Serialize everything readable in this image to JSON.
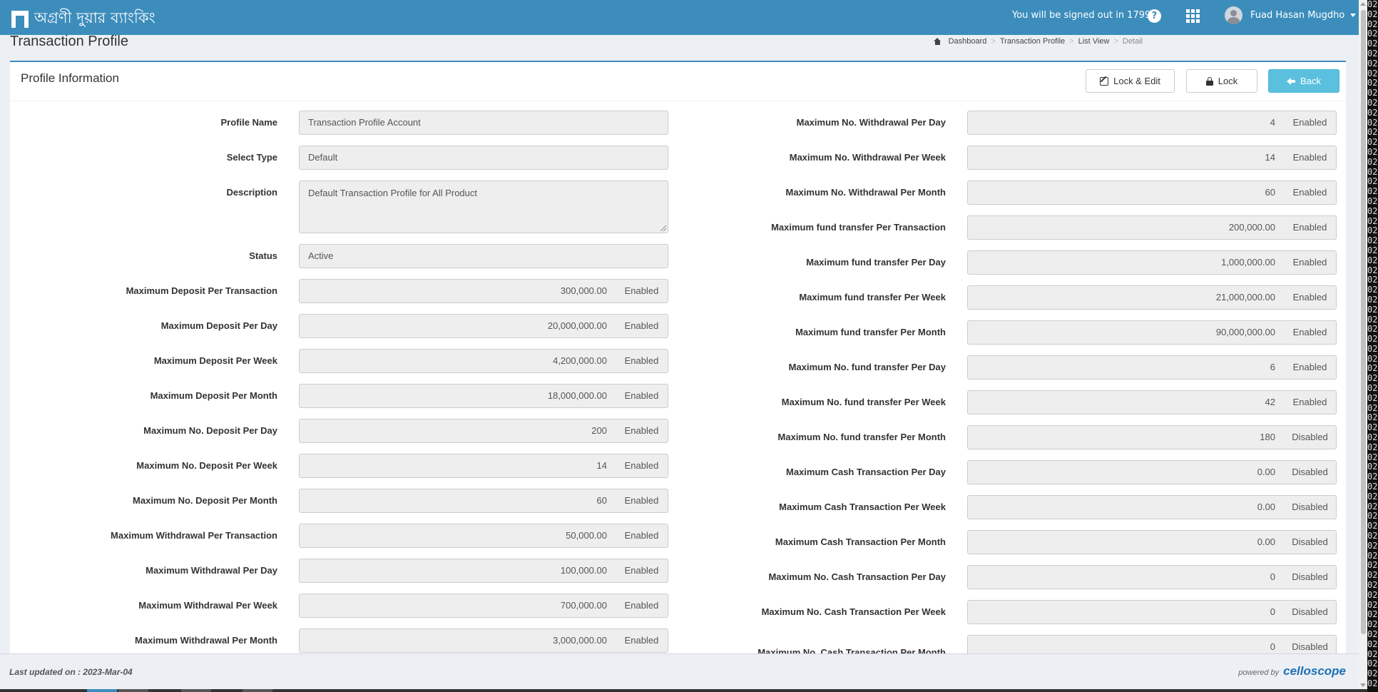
{
  "brand": {
    "title": "অগ্রণী দুয়ার ব্যাংকিং"
  },
  "topbar": {
    "session_text": "You will be signed out in 1799s",
    "user_name": "Fuad Hasan Mugdho"
  },
  "page": {
    "title": "Transaction Profile"
  },
  "breadcrumb": [
    "Dashboard",
    "Transaction Profile",
    "List View",
    "Detail"
  ],
  "box": {
    "title": "Profile Information"
  },
  "buttons": {
    "lock_edit": "Lock & Edit",
    "lock": "Lock",
    "back": "Back"
  },
  "colors": {
    "primary": "#3c8dbc",
    "info_button": "#5bc0de",
    "field_bg": "#eeeeee"
  },
  "text_fields": [
    {
      "label": "Profile Name",
      "value": "Transaction Profile Account"
    },
    {
      "label": "Select Type",
      "value": "Default"
    },
    {
      "label": "Description",
      "value": "Default Transaction Profile for All Product"
    },
    {
      "label": "Status",
      "value": "Active"
    }
  ],
  "left_limits": [
    {
      "label": "Maximum Deposit Per Transaction",
      "value": "300,000.00",
      "state": "Enabled"
    },
    {
      "label": "Maximum Deposit Per Day",
      "value": "20,000,000.00",
      "state": "Enabled"
    },
    {
      "label": "Maximum Deposit Per Week",
      "value": "4,200,000.00",
      "state": "Enabled"
    },
    {
      "label": "Maximum Deposit Per Month",
      "value": "18,000,000.00",
      "state": "Enabled"
    },
    {
      "label": "Maximum No. Deposit Per Day",
      "value": "200",
      "state": "Enabled"
    },
    {
      "label": "Maximum No. Deposit Per Week",
      "value": "14",
      "state": "Enabled"
    },
    {
      "label": "Maximum No. Deposit Per Month",
      "value": "60",
      "state": "Enabled"
    },
    {
      "label": "Maximum Withdrawal Per Transaction",
      "value": "50,000.00",
      "state": "Enabled"
    },
    {
      "label": "Maximum Withdrawal Per Day",
      "value": "100,000.00",
      "state": "Enabled"
    },
    {
      "label": "Maximum Withdrawal Per Week",
      "value": "700,000.00",
      "state": "Enabled"
    },
    {
      "label": "Maximum Withdrawal Per Month",
      "value": "3,000,000.00",
      "state": "Enabled"
    }
  ],
  "right_limits": [
    {
      "label": "Maximum No. Withdrawal Per Day",
      "value": "4",
      "state": "Enabled"
    },
    {
      "label": "Maximum No. Withdrawal Per Week",
      "value": "14",
      "state": "Enabled"
    },
    {
      "label": "Maximum No. Withdrawal Per Month",
      "value": "60",
      "state": "Enabled"
    },
    {
      "label": "Maximum fund transfer Per Transaction",
      "value": "200,000.00",
      "state": "Enabled"
    },
    {
      "label": "Maximum fund transfer Per Day",
      "value": "1,000,000.00",
      "state": "Enabled"
    },
    {
      "label": "Maximum fund transfer Per Week",
      "value": "21,000,000.00",
      "state": "Enabled"
    },
    {
      "label": "Maximum fund transfer Per Month",
      "value": "90,000,000.00",
      "state": "Enabled"
    },
    {
      "label": "Maximum No. fund transfer Per Day",
      "value": "6",
      "state": "Enabled"
    },
    {
      "label": "Maximum No. fund transfer Per Week",
      "value": "42",
      "state": "Enabled"
    },
    {
      "label": "Maximum No. fund transfer Per Month",
      "value": "180",
      "state": "Disabled"
    },
    {
      "label": "Maximum Cash Transaction Per Day",
      "value": "0.00",
      "state": "Disabled"
    },
    {
      "label": "Maximum Cash Transaction Per Week",
      "value": "0.00",
      "state": "Disabled"
    },
    {
      "label": "Maximum Cash Transaction Per Month",
      "value": "0.00",
      "state": "Disabled"
    },
    {
      "label": "Maximum No. Cash Transaction Per Day",
      "value": "0",
      "state": "Disabled"
    },
    {
      "label": "Maximum No. Cash Transaction Per Week",
      "value": "0",
      "state": "Disabled"
    },
    {
      "label": "Maximum No. Cash Transaction Per Month",
      "value": "0",
      "state": "Disabled"
    }
  ],
  "footer": {
    "last_updated": "Last updated on : 2023-Mar-04",
    "powered_by": "powered by",
    "vendor": "celloscope"
  },
  "edge_strip_text": "02"
}
